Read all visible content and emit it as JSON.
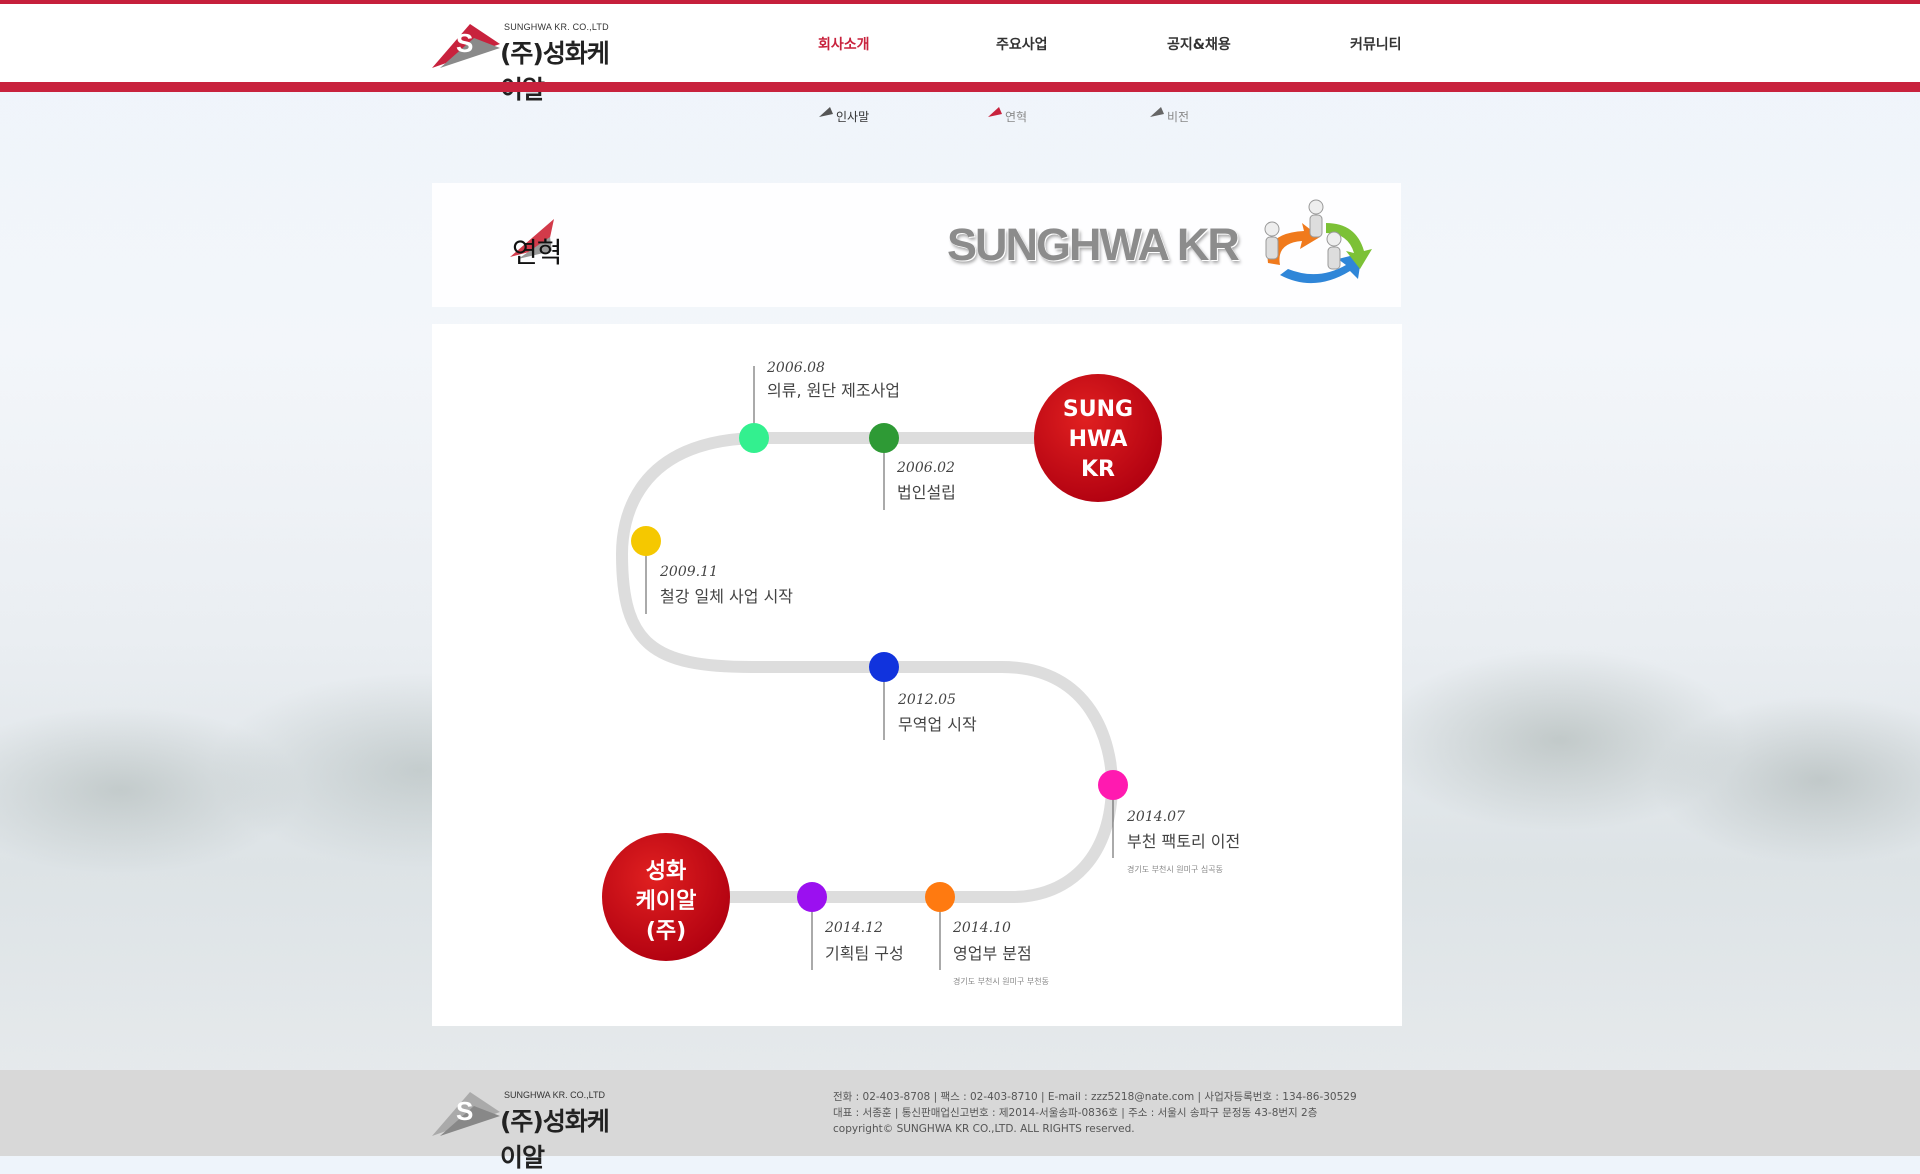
{
  "brand": {
    "name_en": "SUNGHWA KR. CO.,LTD",
    "name_ko": "(주)성화케이알"
  },
  "nav": {
    "items": [
      "회사소개",
      "주요사업",
      "공지&채용",
      "커뮤니티"
    ],
    "active": "회사소개"
  },
  "subnav": {
    "items": [
      "인사말",
      "연혁",
      "비전"
    ]
  },
  "banner": {
    "title": "연혁",
    "brand": "SUNGHWA KR"
  },
  "timeline": {
    "start_label": [
      "SUNG",
      "HWA",
      "KR"
    ],
    "end_label": [
      "성화",
      "케이알",
      "(주)"
    ],
    "events": [
      {
        "date": "2006.08",
        "desc": "의류, 원단 제조사업",
        "color": "#33f08f",
        "addr": ""
      },
      {
        "date": "2006.02",
        "desc": "법인설립",
        "color": "#2e9a35",
        "addr": ""
      },
      {
        "date": "2009.11",
        "desc": "철강 일체 사업 시작",
        "color": "#f5c800",
        "addr": ""
      },
      {
        "date": "2012.05",
        "desc": "무역업 시작",
        "color": "#1133dd",
        "addr": ""
      },
      {
        "date": "2014.07",
        "desc": "부천 팩토리 이전",
        "color": "#ff1ab0",
        "addr": "경기도 부천시 원미구 심곡동"
      },
      {
        "date": "2014.10",
        "desc": "영업부 분점",
        "color": "#ff7a10",
        "addr": "경기도 부천시 원미구 부천동"
      },
      {
        "date": "2014.12",
        "desc": "기획팀 구성",
        "color": "#9b10f0",
        "addr": ""
      }
    ]
  },
  "footer": {
    "line1": "전화 : 02-403-8708  |  팩스 : 02-403-8710   |   E-mail : zzz5218@nate.com  |  사업자등록번호 : 134-86-30529",
    "line2": "대표 : 서종훈  |  통신판매업신고번호 : 제2014-서울송파-0836호  |   주소 : 서울시 송파구 문정동 43-8번지 2층",
    "line3": "copyright© SUNGHWA KR CO.,LTD. ALL RIGHTS reserved."
  },
  "colors": {
    "accent": "#c8223d",
    "track": "#dddddd",
    "circle_red": "#cc0d15"
  }
}
